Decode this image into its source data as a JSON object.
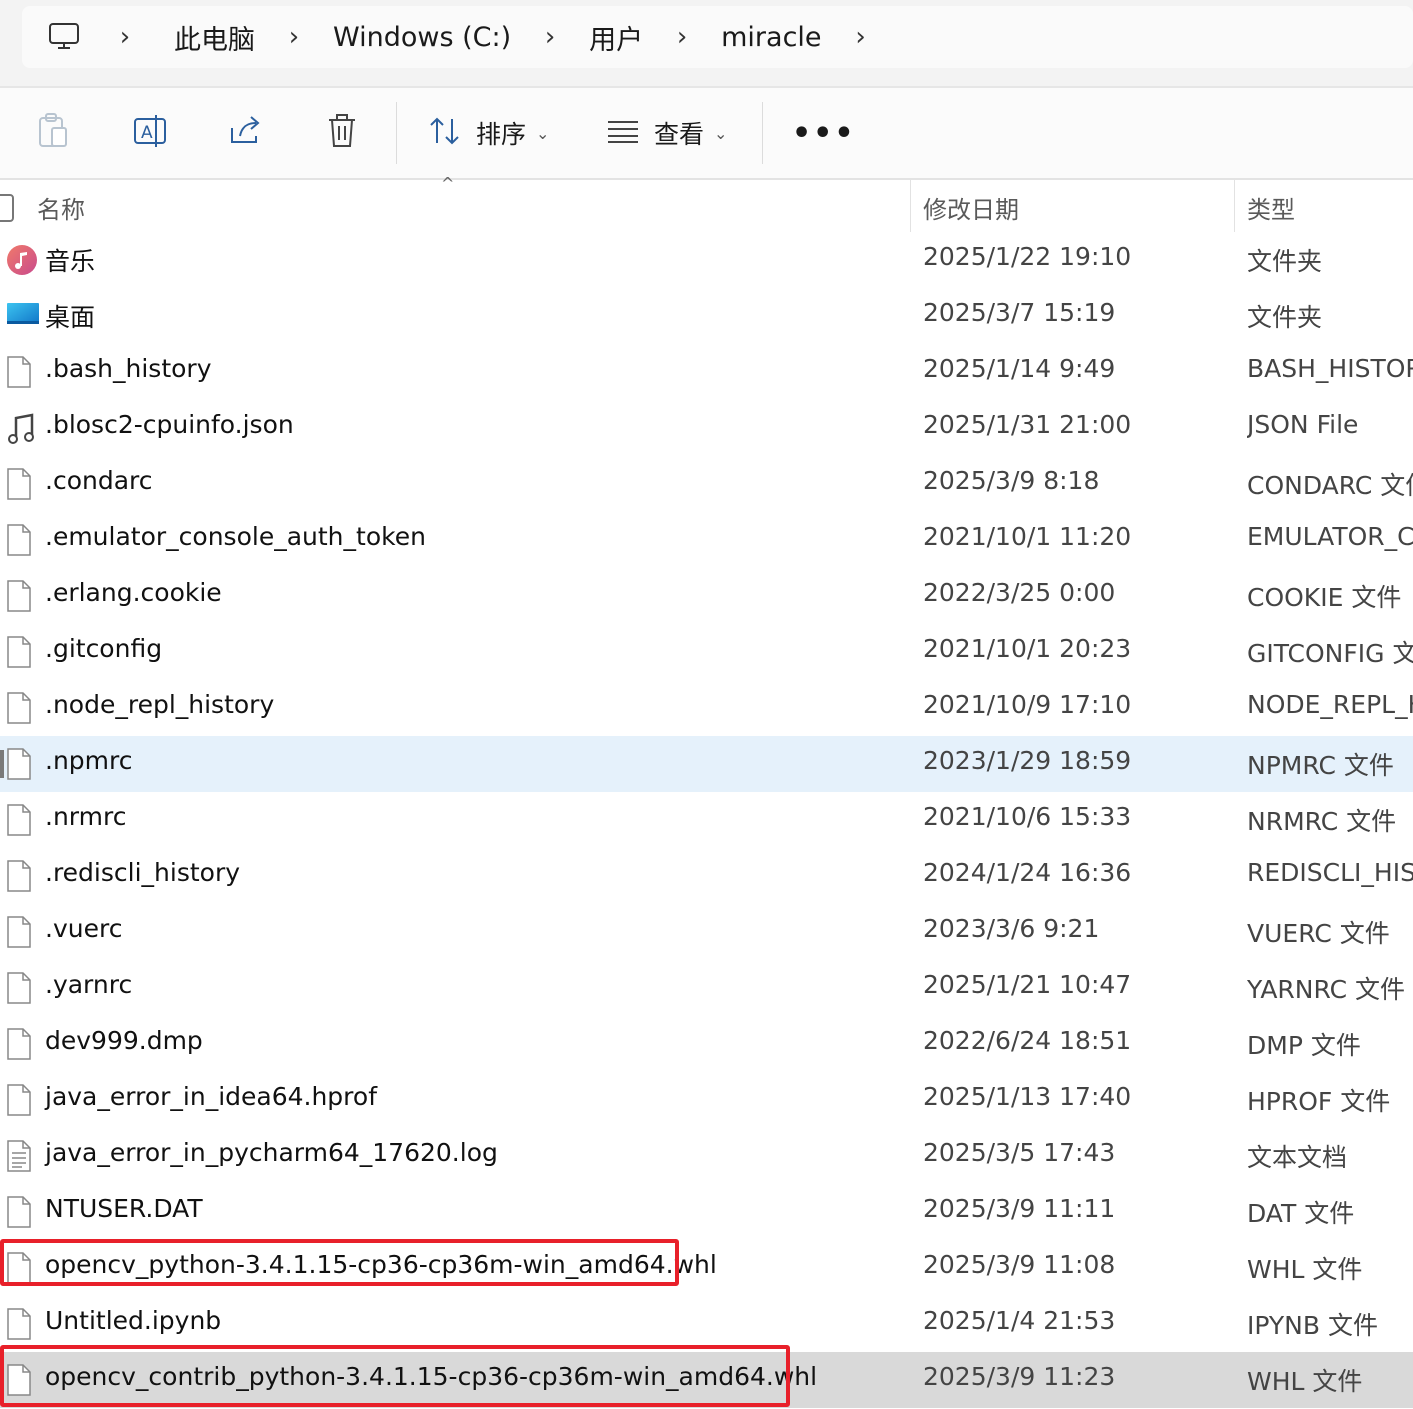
{
  "breadcrumb": [
    "此电脑",
    "Windows (C:)",
    "用户",
    "miracle"
  ],
  "toolbar": {
    "sort_label": "排序",
    "view_label": "查看"
  },
  "columns": {
    "name": "名称",
    "date": "修改日期",
    "type": "类型"
  },
  "files": [
    {
      "name": "音乐",
      "date": "2025/1/22 19:10",
      "type": "文件夹",
      "icon": "music-folder"
    },
    {
      "name": "桌面",
      "date": "2025/3/7 15:19",
      "type": "文件夹",
      "icon": "desktop-folder"
    },
    {
      "name": ".bash_history",
      "date": "2025/1/14 9:49",
      "type": "BASH_HISTORY",
      "icon": "file"
    },
    {
      "name": ".blosc2-cpuinfo.json",
      "date": "2025/1/31 21:00",
      "type": "JSON File",
      "icon": "json-file"
    },
    {
      "name": ".condarc",
      "date": "2025/3/9 8:18",
      "type": "CONDARC 文件",
      "icon": "file"
    },
    {
      "name": ".emulator_console_auth_token",
      "date": "2021/10/1 11:20",
      "type": "EMULATOR_CONSOLE",
      "icon": "file"
    },
    {
      "name": ".erlang.cookie",
      "date": "2022/3/25 0:00",
      "type": "COOKIE 文件",
      "icon": "file"
    },
    {
      "name": ".gitconfig",
      "date": "2021/10/1 20:23",
      "type": "GITCONFIG 文件",
      "icon": "file"
    },
    {
      "name": ".node_repl_history",
      "date": "2021/10/9 17:10",
      "type": "NODE_REPL_HISTORY",
      "icon": "file"
    },
    {
      "name": ".npmrc",
      "date": "2023/1/29 18:59",
      "type": "NPMRC 文件",
      "icon": "file"
    },
    {
      "name": ".nrmrc",
      "date": "2021/10/6 15:33",
      "type": "NRMRC 文件",
      "icon": "file"
    },
    {
      "name": ".rediscli_history",
      "date": "2024/1/24 16:36",
      "type": "REDISCLI_HISTORY",
      "icon": "file"
    },
    {
      "name": ".vuerc",
      "date": "2023/3/6 9:21",
      "type": "VUERC 文件",
      "icon": "file"
    },
    {
      "name": ".yarnrc",
      "date": "2025/1/21 10:47",
      "type": "YARNRC 文件",
      "icon": "file"
    },
    {
      "name": "dev999.dmp",
      "date": "2022/6/24 18:51",
      "type": "DMP 文件",
      "icon": "file"
    },
    {
      "name": "java_error_in_idea64.hprof",
      "date": "2025/1/13 17:40",
      "type": "HPROF 文件",
      "icon": "file"
    },
    {
      "name": "java_error_in_pycharm64_17620.log",
      "date": "2025/3/5 17:43",
      "type": "文本文档",
      "icon": "text-file"
    },
    {
      "name": "NTUSER.DAT",
      "date": "2025/3/9 11:11",
      "type": "DAT 文件",
      "icon": "file"
    },
    {
      "name": "opencv_python-3.4.1.15-cp36-cp36m-win_amd64.whl",
      "date": "2025/3/9 11:08",
      "type": "WHL 文件",
      "icon": "file"
    },
    {
      "name": "Untitled.ipynb",
      "date": "2025/1/4 21:53",
      "type": "IPYNB 文件",
      "icon": "file"
    },
    {
      "name": "opencv_contrib_python-3.4.1.15-cp36-cp36m-win_amd64.whl",
      "date": "2025/3/9 11:23",
      "type": "WHL 文件",
      "icon": "file"
    }
  ],
  "hovered_row": ".npmrc",
  "selected_row": "opencv_contrib_python-3.4.1.15-cp36-cp36m-win_amd64.whl",
  "highlighted_rows": [
    "opencv_python-3.4.1.15-cp36-cp36m-win_amd64.whl",
    "opencv_contrib_python-3.4.1.15-cp36-cp36m-win_amd64.whl"
  ],
  "colors": {
    "hover": "#e5f1fb",
    "selected": "#d9d9d9",
    "annotation": "#e8202a"
  }
}
